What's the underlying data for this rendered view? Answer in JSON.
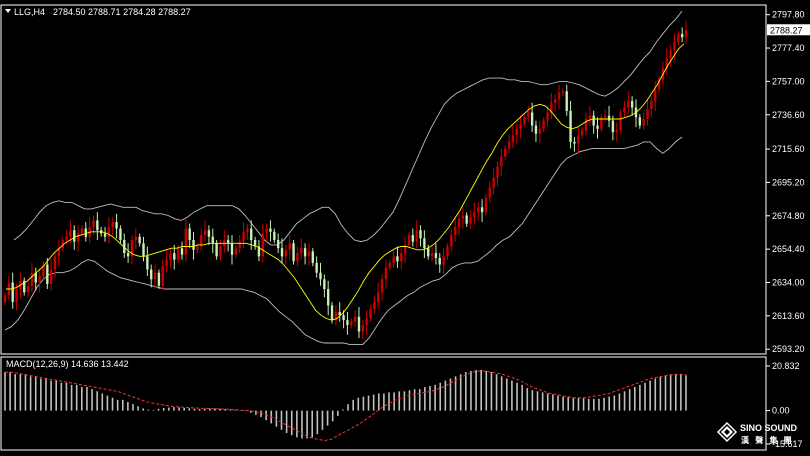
{
  "header": {
    "symbol_label": "LLG,H4",
    "ohlc_label": "2784.50 2788.71 2784.28 2788.27",
    "macd_label": "MACD(12,26,9) 14.636 13.442"
  },
  "watermark": {
    "brand_en": "SINO SOUND",
    "brand_cn": "漢 聲 集 團"
  },
  "colors": {
    "background": "#000000",
    "axis": "#ffffff",
    "bull": "#cc0000",
    "bear": "#c8f0b4",
    "ma_fast": "#ffff00",
    "band": "#c0c0c0",
    "macd_hist": "#c0c0c0",
    "macd_signal": "#ff3030",
    "current_price_bg": "#ffffff",
    "current_price_fg": "#000000"
  },
  "chart_data": [
    {
      "type": "candlestick",
      "symbol": "LLG",
      "timeframe": "H4",
      "current_price": 2788.27,
      "y_ticks": [
        2797.8,
        2777.4,
        2757.0,
        2736.6,
        2715.6,
        2695.2,
        2674.8,
        2654.4,
        2634.0,
        2613.6,
        2593.2
      ],
      "ylim": [
        2591.5,
        2802.5
      ],
      "indicators": [
        "moving average",
        "bollinger bands"
      ],
      "close": [
        2626,
        2634,
        2622,
        2630,
        2635,
        2628,
        2632,
        2640,
        2634,
        2638,
        2645,
        2633,
        2642,
        2650,
        2655,
        2660,
        2662,
        2666,
        2659,
        2664,
        2667,
        2662,
        2668,
        2672,
        2666,
        2664,
        2662,
        2668,
        2671,
        2667,
        2660,
        2652,
        2650,
        2660,
        2662,
        2658,
        2650,
        2642,
        2636,
        2640,
        2632,
        2644,
        2648,
        2652,
        2648,
        2655,
        2651,
        2667,
        2660,
        2654,
        2656,
        2663,
        2666,
        2662,
        2658,
        2650,
        2656,
        2660,
        2658,
        2651,
        2655,
        2659,
        2665,
        2667,
        2660,
        2656,
        2650,
        2664,
        2667,
        2665,
        2660,
        2655,
        2650,
        2654,
        2658,
        2647,
        2652,
        2655,
        2650,
        2653,
        2646,
        2640,
        2636,
        2630,
        2620,
        2611,
        2616,
        2614,
        2611,
        2608,
        2610,
        2613,
        2604,
        2608,
        2612,
        2618,
        2622,
        2628,
        2636,
        2643,
        2646,
        2650,
        2647,
        2652,
        2657,
        2663,
        2659,
        2666,
        2661,
        2655,
        2650,
        2652,
        2649,
        2645,
        2650,
        2656,
        2663,
        2668,
        2673,
        2675,
        2670,
        2674,
        2677,
        2680,
        2677,
        2686,
        2692,
        2698,
        2705,
        2711,
        2716,
        2720,
        2724,
        2728,
        2731,
        2735,
        2738,
        2730,
        2725,
        2728,
        2733,
        2738,
        2744,
        2746,
        2750,
        2751,
        2739,
        2720,
        2719,
        2724,
        2727,
        2734,
        2736,
        2730,
        2728,
        2735,
        2736,
        2733,
        2726,
        2727,
        2738,
        2741,
        2745,
        2741,
        2735,
        2730,
        2734,
        2740,
        2745,
        2752,
        2758,
        2765,
        2771,
        2776,
        2781,
        2786,
        2784,
        2788.27
      ],
      "ma_fast": [
        2630,
        2630,
        2631,
        2633,
        2635,
        2638,
        2641,
        2644,
        2648,
        2652,
        2655,
        2658,
        2660,
        2662,
        2663,
        2664,
        2665,
        2665,
        2665,
        2664,
        2662,
        2659,
        2656,
        2653,
        2651,
        2650,
        2650,
        2651,
        2652,
        2653,
        2654,
        2655,
        2655,
        2656,
        2656,
        2656,
        2657,
        2657,
        2658,
        2658,
        2658,
        2658,
        2658,
        2658,
        2658,
        2658,
        2657,
        2656,
        2654,
        2652,
        2650,
        2648,
        2645,
        2641,
        2637,
        2632,
        2627,
        2622,
        2617,
        2614,
        2612,
        2611,
        2612,
        2615,
        2619,
        2624,
        2629,
        2635,
        2640,
        2644,
        2648,
        2651,
        2653,
        2655,
        2656,
        2656,
        2655,
        2654,
        2654,
        2655,
        2657,
        2660,
        2664,
        2668,
        2673,
        2678,
        2684,
        2690,
        2696,
        2702,
        2708,
        2713,
        2719,
        2724,
        2728,
        2731,
        2734,
        2737,
        2740,
        2742,
        2743,
        2742,
        2739,
        2735,
        2731,
        2729,
        2728,
        2729,
        2731,
        2733,
        2734,
        2734,
        2734,
        2734,
        2734,
        2734,
        2735,
        2736,
        2738,
        2741,
        2745,
        2750,
        2755,
        2761,
        2767,
        2772,
        2777,
        2780
      ],
      "bollinger_upper": [
        2660,
        2663,
        2667,
        2672,
        2677,
        2681,
        2683,
        2684,
        2683,
        2683,
        2681,
        2679,
        2679,
        2680,
        2681,
        2682,
        2681,
        2680,
        2680,
        2680,
        2678,
        2677,
        2676,
        2676,
        2675,
        2673,
        2672,
        2674,
        2677,
        2679,
        2681,
        2681,
        2681,
        2681,
        2681,
        2679,
        2675,
        2670,
        2665,
        2660,
        2657,
        2657,
        2660,
        2665,
        2670,
        2673,
        2676,
        2678,
        2680,
        2680,
        2676,
        2669,
        2664,
        2660,
        2659,
        2660,
        2663,
        2667,
        2672,
        2677,
        2685,
        2694,
        2703,
        2712,
        2721,
        2729,
        2736,
        2743,
        2747,
        2750,
        2752,
        2754,
        2756,
        2758,
        2759,
        2759,
        2759,
        2758,
        2758,
        2757,
        2757,
        2756,
        2755,
        2755,
        2756,
        2757,
        2757,
        2756,
        2755,
        2753,
        2751,
        2749,
        2748,
        2750,
        2753,
        2757,
        2761,
        2766,
        2771,
        2775,
        2781,
        2786,
        2791,
        2795,
        2800
      ],
      "bollinger_lower": [
        2605,
        2607,
        2611,
        2617,
        2624,
        2631,
        2636,
        2639,
        2640,
        2640,
        2641,
        2643,
        2646,
        2648,
        2647,
        2644,
        2641,
        2639,
        2637,
        2636,
        2635,
        2634,
        2633,
        2632,
        2631,
        2630,
        2630,
        2630,
        2630,
        2630,
        2630,
        2630,
        2630,
        2630,
        2630,
        2630,
        2630,
        2630,
        2629,
        2628,
        2626,
        2624,
        2620,
        2616,
        2613,
        2610,
        2606,
        2602,
        2600,
        2598,
        2597,
        2597,
        2597,
        2597,
        2596,
        2596,
        2596,
        2600,
        2606,
        2612,
        2617,
        2620,
        2623,
        2626,
        2628,
        2631,
        2633,
        2635,
        2636,
        2639,
        2643,
        2645,
        2646,
        2646,
        2647,
        2650,
        2653,
        2657,
        2660,
        2662,
        2666,
        2670,
        2676,
        2682,
        2688,
        2694,
        2700,
        2706,
        2710,
        2712,
        2714,
        2715,
        2716,
        2716,
        2716,
        2716,
        2716,
        2716,
        2717,
        2718,
        2720,
        2720,
        2716,
        2713,
        2716,
        2720,
        2723
      ]
    },
    {
      "type": "bar+line",
      "name": "MACD(12,26,9)",
      "main_value": 14.636,
      "signal_value": 13.442,
      "y_ticks_labels": [
        "20.832",
        "0.00",
        "-15.617"
      ],
      "ylim": [
        -15.617,
        20.832
      ],
      "histogram": [
        18,
        18,
        17,
        17,
        17,
        16,
        16,
        15,
        15,
        14,
        14,
        13,
        13,
        12,
        12,
        11,
        11,
        10,
        9,
        8,
        7,
        6,
        5,
        5,
        4,
        3,
        2,
        1,
        0.5,
        0.3,
        0.8,
        1.2,
        1.4,
        1.6,
        1.5,
        1.3,
        1.1,
        0.9,
        0.8,
        0.9,
        1,
        1,
        0.9,
        0.7,
        0.5,
        0.4,
        0.2,
        -0.2,
        -1,
        -2,
        -3,
        -4.5,
        -6,
        -7.5,
        -9,
        -10.5,
        -11.5,
        -12.5,
        -13,
        -13,
        -12.5,
        -11,
        -9,
        -7,
        -5,
        -2.5,
        0.5,
        3,
        5,
        6,
        6.5,
        7,
        7.5,
        8,
        8,
        8.5,
        8.5,
        9,
        9,
        9.5,
        10,
        10,
        11,
        11.5,
        12,
        13,
        14,
        15,
        16,
        17,
        18,
        18.5,
        19,
        19,
        18.5,
        18,
        17,
        16,
        15,
        14,
        13,
        12,
        10.5,
        9.5,
        9,
        8.5,
        8,
        7.5,
        7,
        6.5,
        6.5,
        6,
        6,
        6,
        5.5,
        5.5,
        5.5,
        6,
        6.5,
        7,
        8,
        9,
        10,
        11,
        12,
        13,
        14,
        15,
        16,
        16.5,
        17,
        17,
        17,
        16.5
      ],
      "signal": [
        18,
        18,
        17.5,
        17,
        16.5,
        16,
        15.5,
        15,
        14.5,
        14,
        13.5,
        13,
        12.5,
        12,
        11.5,
        11,
        10.5,
        10,
        9.5,
        9,
        8,
        7,
        6,
        5,
        4,
        3.5,
        3,
        2.5,
        2,
        1.8,
        1.6,
        1.4,
        1.2,
        1.1,
        1,
        0.9,
        0.8,
        0.7,
        0.6,
        0.4,
        0.2,
        0,
        -0.5,
        -1,
        -2,
        -3,
        -4.5,
        -6,
        -7.5,
        -9,
        -10.5,
        -12,
        -13,
        -13.5,
        -14,
        -13.5,
        -12,
        -10.5,
        -9,
        -7.5,
        -6,
        -4,
        -2,
        0,
        2,
        3.5,
        5,
        6,
        7,
        7.5,
        8,
        8.5,
        9,
        10,
        11,
        12.5,
        14,
        15.5,
        17,
        18,
        18.5,
        18.5,
        18,
        17.5,
        17,
        16,
        15,
        14,
        12.5,
        11,
        10,
        9,
        8,
        7.5,
        7,
        6.5,
        6,
        6,
        6,
        6.5,
        7,
        7.5,
        8,
        9,
        10,
        11,
        12,
        13,
        14,
        15,
        15.5,
        16,
        16.5,
        17,
        17,
        16.8
      ]
    }
  ]
}
